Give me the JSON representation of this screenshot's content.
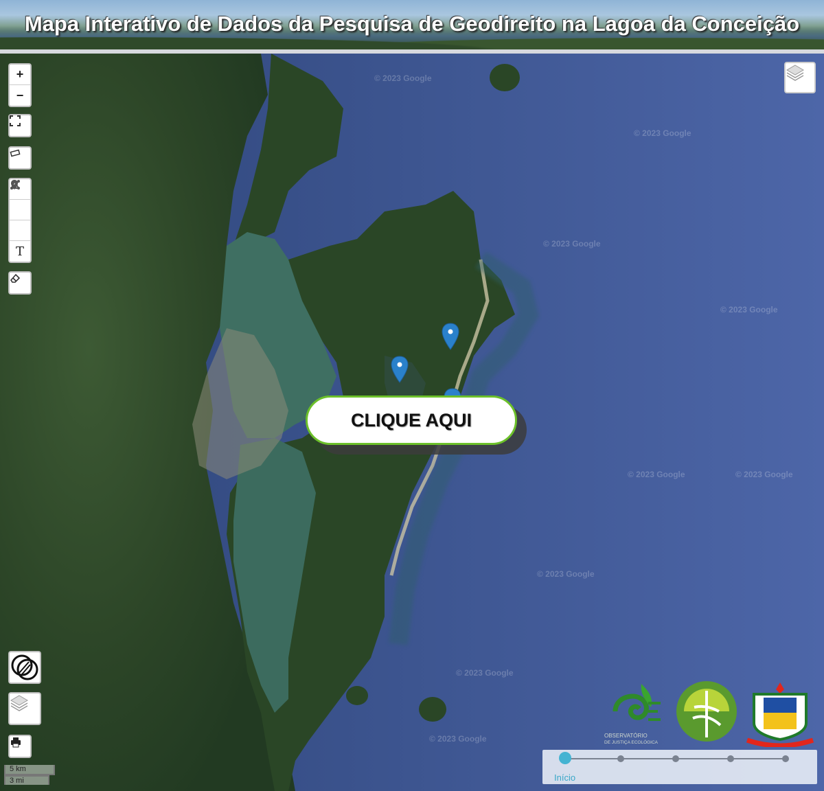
{
  "header": {
    "title": "Mapa Interativo de Dados da Pesquisa de Geodireito na Lagoa da Conceição"
  },
  "map": {
    "watermark": "© 2023 Google",
    "cta_label": "CLIQUE AQUI",
    "markers": [
      "location-marker",
      "location-marker",
      "location-marker"
    ]
  },
  "controls": {
    "zoom_in": "+",
    "zoom_out": "−",
    "draw_text_glyph": "T"
  },
  "scale": {
    "metric": "5 km",
    "imperial": "3 mi"
  },
  "timeline": {
    "current_label": "Início",
    "steps": 5,
    "active_index": 0
  },
  "logos": {
    "observatorio_line1": "OBSERVATÓRIO",
    "observatorio_line2": "DE JUSTIÇA ECOLÓGICA"
  },
  "colors": {
    "ocean": "#3f589a",
    "land": "#2f4d2a",
    "lagoon": "#3f6f62",
    "accent": "#6cc02a",
    "timeline": "#44b3d2"
  }
}
